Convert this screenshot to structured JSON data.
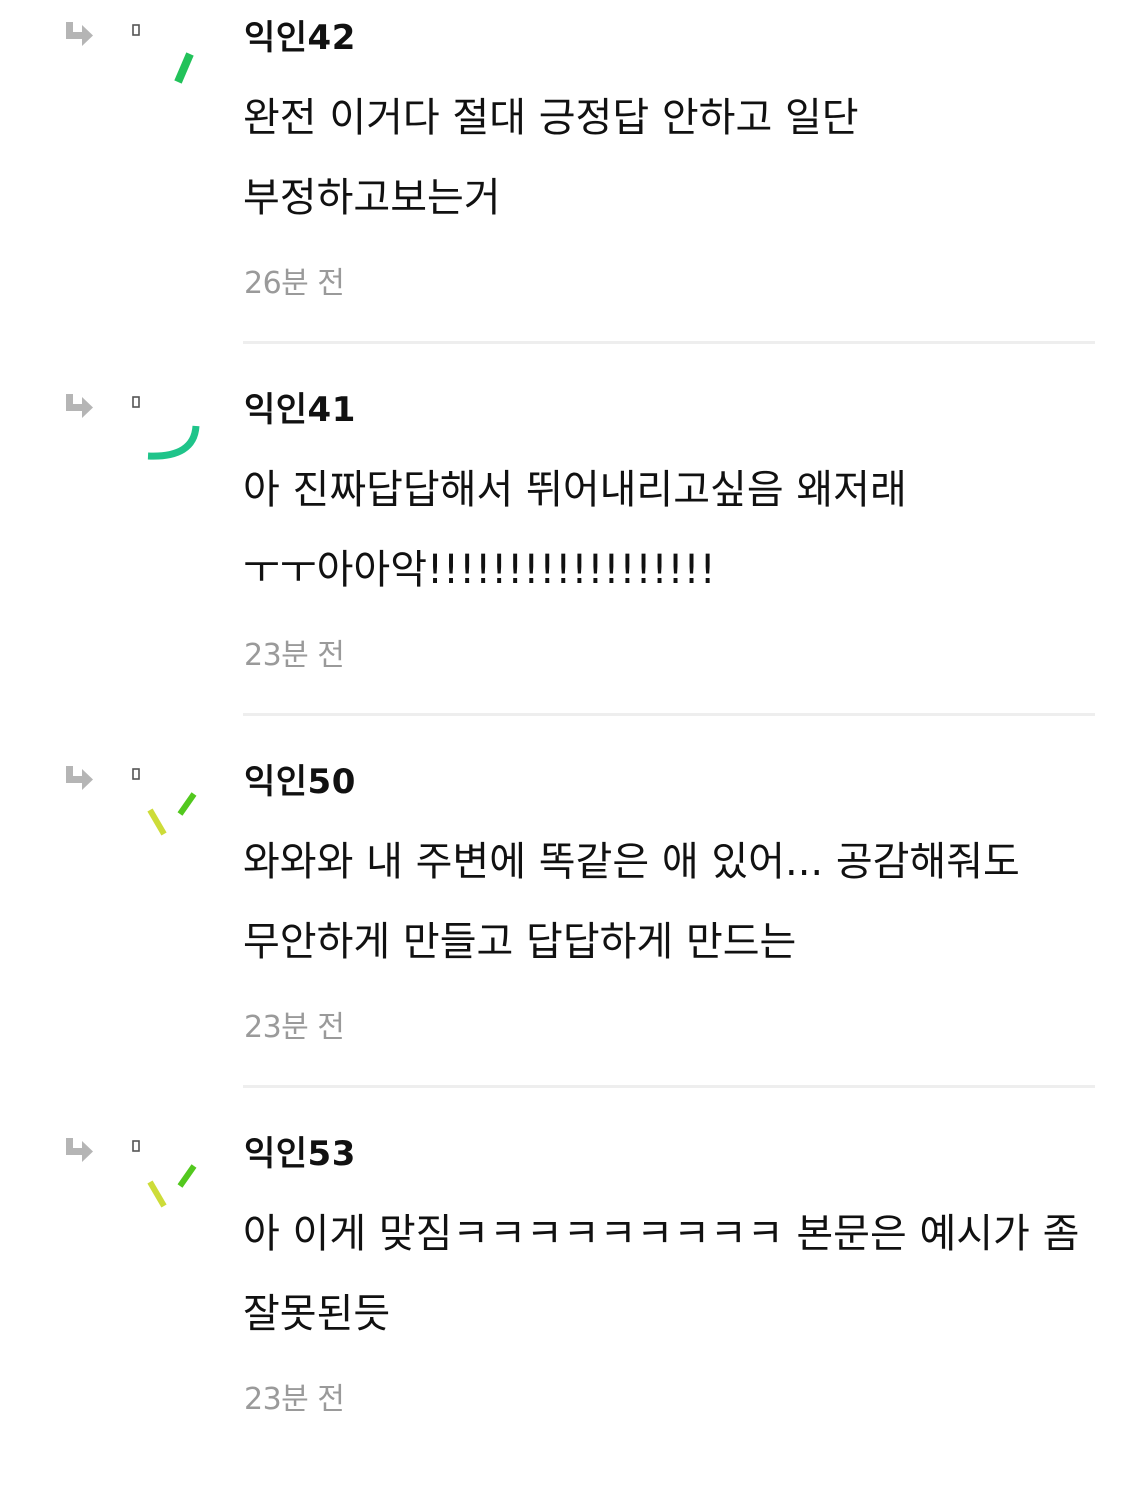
{
  "comments": [
    {
      "author": "익인42",
      "body": "완전 이거다 절대 긍정답 안하고 일단 부정하고보는거",
      "time": "26분 전",
      "icons": {
        "reply": "reply-arrow-icon",
        "avatar": "decorative-stroke-avatar"
      },
      "accent": "#22c25a"
    },
    {
      "author": "익인41",
      "body": "아 진짜답답해서 뛰어내리고싶음 왜저래 ㅜㅜ아아악!!!!!!!!!!!!!!!!!!",
      "time": "23분 전",
      "icons": {
        "reply": "reply-arrow-icon",
        "avatar": "decorative-stroke-avatar"
      },
      "accent": "#1fc48a"
    },
    {
      "author": "익인50",
      "body": "와와와 내 주변에 똑같은 애 있어... 공감해줘도 무안하게 만들고 답답하게 만드는",
      "time": "23분 전",
      "icons": {
        "reply": "reply-arrow-icon",
        "avatar": "decorative-stroke-avatar"
      },
      "accent": "#52c81e"
    },
    {
      "author": "익인53",
      "body": "아 이게 맞짐ㅋㅋㅋㅋㅋㅋㅋㅋㅋ 본문은 예시가 좀 잘못된듯",
      "time": "23분 전",
      "icons": {
        "reply": "reply-arrow-icon",
        "avatar": "decorative-stroke-avatar"
      },
      "accent": "#52c81e"
    }
  ]
}
